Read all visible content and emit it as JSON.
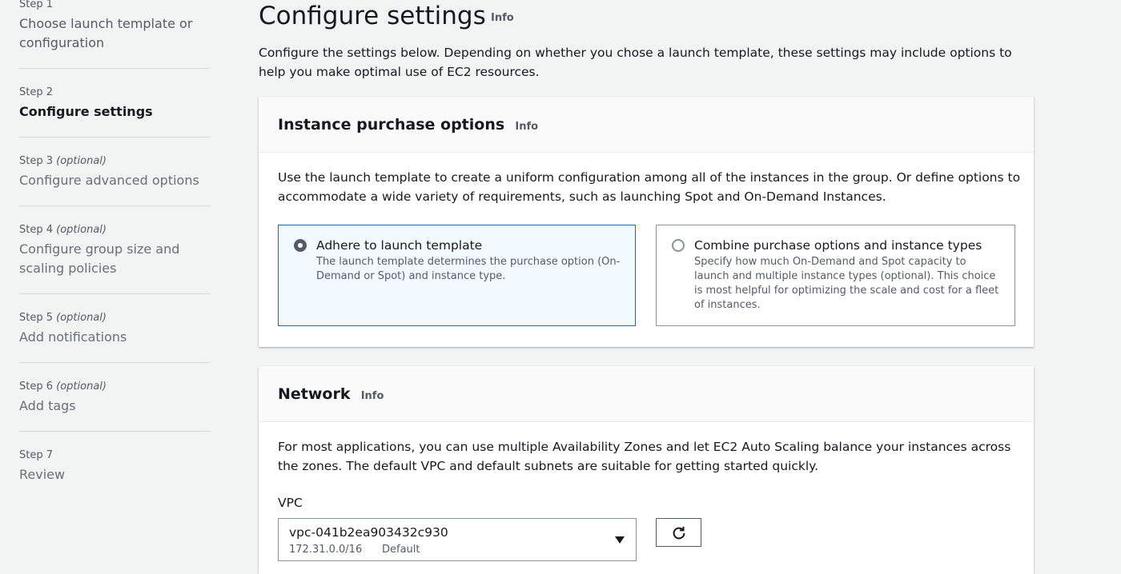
{
  "sidebar": {
    "steps": [
      {
        "label": "Step 1",
        "optional": "",
        "title": "Choose launch template or configuration"
      },
      {
        "label": "Step 2",
        "optional": "",
        "title": "Configure settings"
      },
      {
        "label": "Step 3",
        "optional": "(optional)",
        "title": "Configure advanced options"
      },
      {
        "label": "Step 4",
        "optional": "(optional)",
        "title": "Configure group size and scaling policies"
      },
      {
        "label": "Step 5",
        "optional": "(optional)",
        "title": "Add notifications"
      },
      {
        "label": "Step 6",
        "optional": "(optional)",
        "title": "Add tags"
      },
      {
        "label": "Step 7",
        "optional": "",
        "title": "Review"
      }
    ]
  },
  "main": {
    "title": "Configure settings",
    "info": "Info",
    "description": "Configure the settings below. Depending on whether you chose a launch template, these settings may include options to help you make optimal use of EC2 resources."
  },
  "purchase": {
    "title": "Instance purchase options",
    "info": "Info",
    "description": "Use the launch template to create a uniform configuration among all of the instances in the group. Or define options to accommodate a wide variety of requirements, such as launching Spot and On-Demand Instances.",
    "options": [
      {
        "title": "Adhere to launch template",
        "desc": "The launch template determines the purchase option (On-Demand or Spot) and instance type.",
        "selected": true
      },
      {
        "title": "Combine purchase options and instance types",
        "desc": "Specify how much On-Demand and Spot capacity to launch and multiple instance types (optional). This choice is most helpful for optimizing the scale and cost for a fleet of instances.",
        "selected": false
      }
    ]
  },
  "network": {
    "title": "Network",
    "info": "Info",
    "description": "For most applications, you can use multiple Availability Zones and let EC2 Auto Scaling balance your instances across the zones. The default VPC and default subnets are suitable for getting started quickly.",
    "vpc_label": "VPC",
    "vpc_value": "vpc-041b2ea903432c930",
    "vpc_cidr": "172.31.0.0/16",
    "vpc_tag": "Default",
    "icons": {
      "refresh": "refresh-icon",
      "dropdown": "caret-down-icon",
      "radio": "radio-icon"
    }
  },
  "colors": {
    "selected_border": "#0073bb",
    "selected_bg": "#f1faff",
    "background": "#f2f3f3"
  }
}
